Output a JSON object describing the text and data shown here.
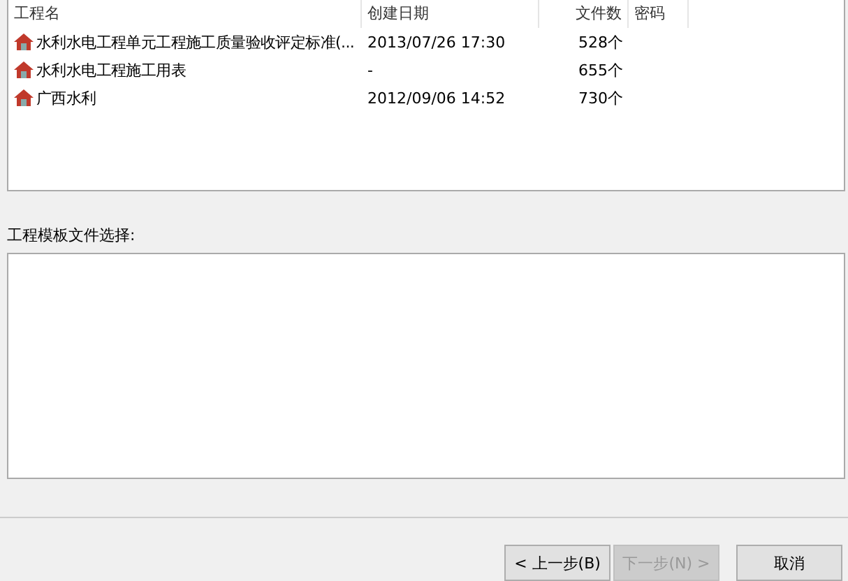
{
  "project_list": {
    "columns": [
      "工程名",
      "创建日期",
      "文件数",
      "密码"
    ],
    "rows": [
      {
        "name": "水利水电工程单元工程施工质量验收评定标准(...",
        "date": "2013/07/26 17:30",
        "files": "528个",
        "password": ""
      },
      {
        "name": "水利水电工程施工用表",
        "date": "-",
        "files": "655个",
        "password": ""
      },
      {
        "name": "广西水利",
        "date": "2012/09/06 14:52",
        "files": "730个",
        "password": ""
      }
    ]
  },
  "template_label": "工程模板文件选择:",
  "buttons": [
    {
      "label": "< 上一步(B)",
      "disabled": false
    },
    {
      "label": "下一步(N) >",
      "disabled": true
    },
    {
      "label": "取消",
      "disabled": false
    }
  ]
}
